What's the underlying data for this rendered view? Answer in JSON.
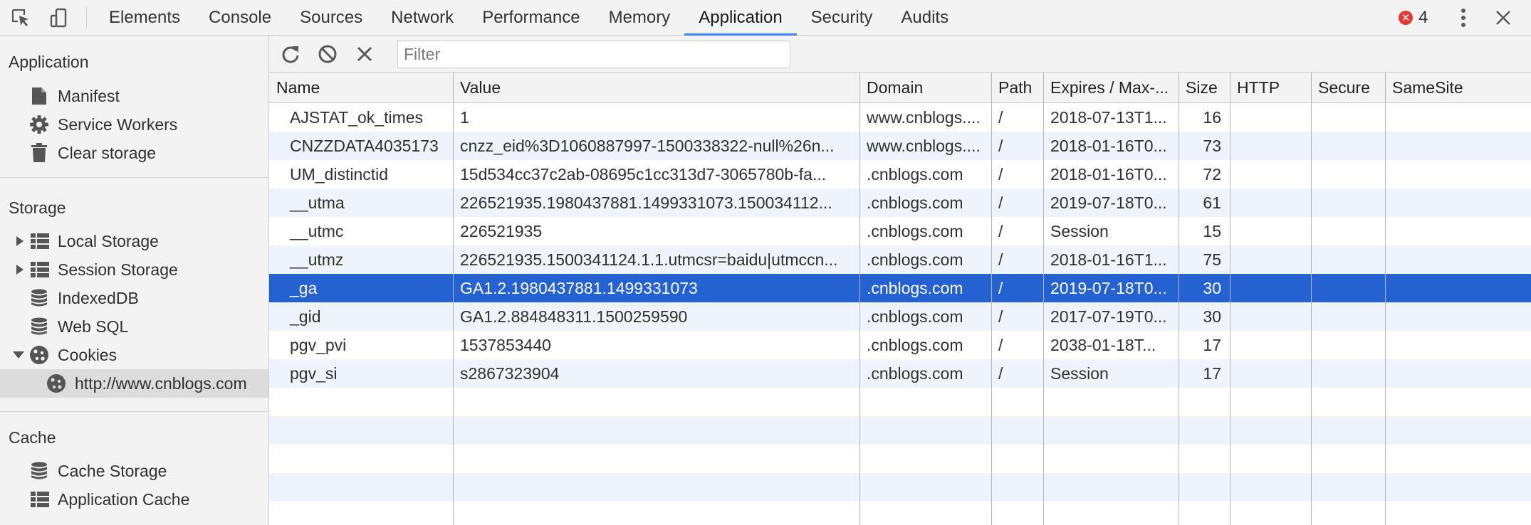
{
  "devtools_tabs": [
    "Elements",
    "Console",
    "Sources",
    "Network",
    "Performance",
    "Memory",
    "Application",
    "Security",
    "Audits"
  ],
  "active_tab": "Application",
  "error_count": "4",
  "icons": {
    "inspect": "inspect-element-icon",
    "device": "device-toolbar-icon",
    "error": "error-icon",
    "menu": "more-vert-icon",
    "close": "close-icon",
    "refresh": "refresh-icon",
    "clear_all": "clear-all-icon",
    "delete": "delete-icon"
  },
  "colors": {
    "accent": "#3e82f7",
    "selected_row": "#2461d1",
    "alt_row": "#eef3fc",
    "error": "#e53935"
  },
  "sidebar": {
    "application_heading": "Application",
    "application_items": [
      "Manifest",
      "Service Workers",
      "Clear storage"
    ],
    "storage_heading": "Storage",
    "storage_items": [
      "Local Storage",
      "Session Storage",
      "IndexedDB",
      "Web SQL",
      "Cookies"
    ],
    "cookie_origin": "http://www.cnblogs.com",
    "cache_heading": "Cache",
    "cache_items": [
      "Cache Storage",
      "Application Cache"
    ]
  },
  "toolbar": {
    "filter_placeholder": "Filter"
  },
  "table": {
    "columns": [
      "Name",
      "Value",
      "Domain",
      "Path",
      "Expires / Max-...",
      "Size",
      "HTTP",
      "Secure",
      "SameSite"
    ],
    "selected_row": 6,
    "rows": [
      [
        "AJSTAT_ok_times",
        "1",
        "www.cnblogs....",
        "/",
        "2018-07-13T1...",
        "16",
        "",
        "",
        ""
      ],
      [
        "CNZZDATA4035173",
        "cnzz_eid%3D1060887997-1500338322-null%26n...",
        "www.cnblogs....",
        "/",
        "2018-01-16T0...",
        "73",
        "",
        "",
        ""
      ],
      [
        "UM_distinctid",
        "15d534cc37c2ab-08695c1cc313d7-3065780b-fa...",
        ".cnblogs.com",
        "/",
        "2018-01-16T0...",
        "72",
        "",
        "",
        ""
      ],
      [
        "__utma",
        "226521935.1980437881.1499331073.150034112...",
        ".cnblogs.com",
        "/",
        "2019-07-18T0...",
        "61",
        "",
        "",
        ""
      ],
      [
        "__utmc",
        "226521935",
        ".cnblogs.com",
        "/",
        "Session",
        "15",
        "",
        "",
        ""
      ],
      [
        "__utmz",
        "226521935.1500341124.1.1.utmcsr=baidu|utmccn...",
        ".cnblogs.com",
        "/",
        "2018-01-16T1...",
        "75",
        "",
        "",
        ""
      ],
      [
        "_ga",
        "GA1.2.1980437881.1499331073",
        ".cnblogs.com",
        "/",
        "2019-07-18T0...",
        "30",
        "",
        "",
        ""
      ],
      [
        "_gid",
        "GA1.2.884848311.1500259590",
        ".cnblogs.com",
        "/",
        "2017-07-19T0...",
        "30",
        "",
        "",
        ""
      ],
      [
        "pgv_pvi",
        "1537853440",
        ".cnblogs.com",
        "/",
        "2038-01-18T...",
        "17",
        "",
        "",
        ""
      ],
      [
        "pgv_si",
        "s2867323904",
        ".cnblogs.com",
        "/",
        "Session",
        "17",
        "",
        "",
        ""
      ]
    ]
  }
}
